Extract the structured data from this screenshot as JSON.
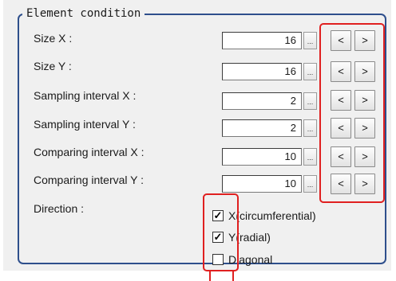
{
  "group": {
    "title": "Element condition"
  },
  "rows": [
    {
      "label": "Size X :",
      "value": "16"
    },
    {
      "label": "Size Y :",
      "value": "16"
    },
    {
      "label": "Sampling interval X :",
      "value": "2"
    },
    {
      "label": "Sampling interval Y :",
      "value": "2"
    },
    {
      "label": "Comparing interval X :",
      "value": "10"
    },
    {
      "label": "Comparing interval Y :",
      "value": "10"
    }
  ],
  "ellipsis_label": "...",
  "decrement_label": "<",
  "increment_label": ">",
  "direction": {
    "label": "Direction :",
    "options": [
      {
        "label": "X(circumferential)",
        "checked": true
      },
      {
        "label": "Y(radial)",
        "checked": true
      },
      {
        "label": "Diagonal",
        "checked": false
      }
    ]
  },
  "colors": {
    "highlight": "#e02020",
    "group_border": "#2e4f8c",
    "panel": "#f0f0f0"
  }
}
